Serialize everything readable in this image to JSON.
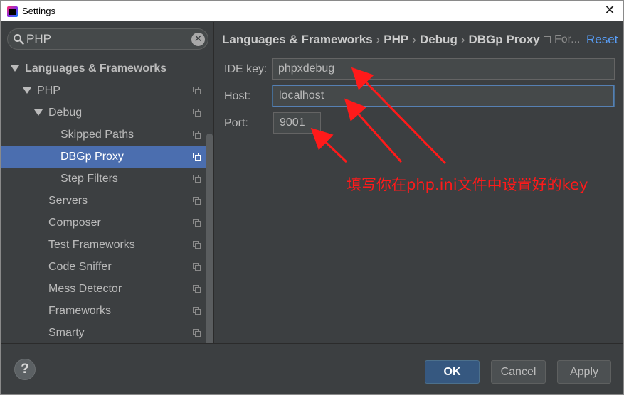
{
  "window": {
    "title": "Settings"
  },
  "search": {
    "value": "PHP"
  },
  "tree": [
    {
      "label": "Languages & Frameworks",
      "level": 0,
      "expanded": true,
      "bold": true,
      "copy": false,
      "selected": false
    },
    {
      "label": "PHP",
      "level": 1,
      "expanded": true,
      "bold": false,
      "copy": true,
      "selected": false
    },
    {
      "label": "Debug",
      "level": 2,
      "expanded": true,
      "bold": false,
      "copy": true,
      "selected": false
    },
    {
      "label": "Skipped Paths",
      "level": 3,
      "expanded": false,
      "bold": false,
      "copy": true,
      "selected": false
    },
    {
      "label": "DBGp Proxy",
      "level": 3,
      "expanded": false,
      "bold": false,
      "copy": true,
      "selected": true
    },
    {
      "label": "Step Filters",
      "level": 3,
      "expanded": false,
      "bold": false,
      "copy": true,
      "selected": false
    },
    {
      "label": "Servers",
      "level": 2,
      "expanded": false,
      "bold": false,
      "copy": true,
      "selected": false
    },
    {
      "label": "Composer",
      "level": 2,
      "expanded": false,
      "bold": false,
      "copy": true,
      "selected": false
    },
    {
      "label": "Test Frameworks",
      "level": 2,
      "expanded": false,
      "bold": false,
      "copy": true,
      "selected": false
    },
    {
      "label": "Code Sniffer",
      "level": 2,
      "expanded": false,
      "bold": false,
      "copy": true,
      "selected": false
    },
    {
      "label": "Mess Detector",
      "level": 2,
      "expanded": false,
      "bold": false,
      "copy": true,
      "selected": false
    },
    {
      "label": "Frameworks",
      "level": 2,
      "expanded": false,
      "bold": false,
      "copy": true,
      "selected": false
    },
    {
      "label": "Smarty",
      "level": 2,
      "expanded": false,
      "bold": false,
      "copy": true,
      "selected": false
    }
  ],
  "breadcrumb": [
    "Languages & Frameworks",
    "PHP",
    "Debug",
    "DBGp Proxy"
  ],
  "for_project": "For...",
  "reset_label": "Reset",
  "form": {
    "ide_key_label": "IDE key:",
    "ide_key_value": "phpxdebug",
    "host_label": "Host:",
    "host_value": "localhost",
    "port_label": "Port:",
    "port_value": "9001"
  },
  "annotation": "填写你在php.ini文件中设置好的key",
  "buttons": {
    "help": "?",
    "ok": "OK",
    "cancel": "Cancel",
    "apply": "Apply"
  },
  "colors": {
    "selection": "#4b6eaf",
    "link": "#589df6",
    "annotation": "#ff1a1a",
    "ok_button": "#365880"
  }
}
